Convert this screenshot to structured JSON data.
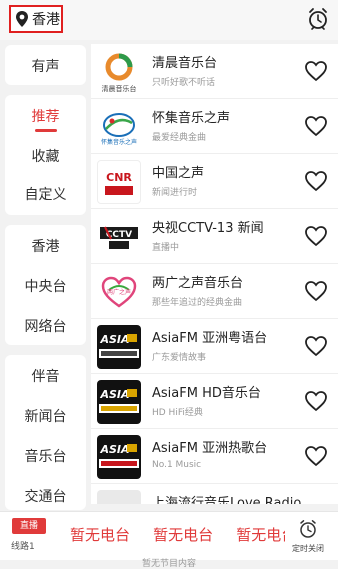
{
  "location": {
    "label": "香港"
  },
  "left_menu": {
    "top_card": [
      "有声"
    ],
    "middle_card": [
      "推荐",
      "收藏",
      "自定义"
    ],
    "region_card": [
      "香港",
      "中央台",
      "网络台"
    ],
    "genre_card": [
      "伴音",
      "新闻台",
      "音乐台",
      "交通台"
    ]
  },
  "stations": [
    {
      "title": "清晨音乐台",
      "subtitle": "只听好歌不听话",
      "logo_icon": "qingchen-logo-icon",
      "logo_text": "清晨音乐台"
    },
    {
      "title": "怀集音乐之声",
      "subtitle": "最爱经典金曲",
      "logo_icon": "huaiji-logo-icon",
      "logo_text": "怀集音乐之声"
    },
    {
      "title": "中国之声",
      "subtitle": "新闻进行时",
      "logo_icon": "cnr-logo-icon",
      "logo_text": "CNR"
    },
    {
      "title": "央视CCTV-13 新闻",
      "subtitle": "直播中",
      "logo_icon": "cctv-logo-icon",
      "logo_text": "CCTV"
    },
    {
      "title": "两广之声音乐台",
      "subtitle": "那些年追过的经典金曲",
      "logo_icon": "lianguang-logo-icon",
      "logo_text": "两广之声"
    },
    {
      "title": "AsiaFM 亚洲粤语台",
      "subtitle": "广东爱情故事",
      "logo_icon": "asiafm-yue-logo-icon",
      "logo_text": "ASIA"
    },
    {
      "title": "AsiaFM HD音乐台",
      "subtitle": "HD HiFi经典",
      "logo_icon": "asiafm-hd-logo-icon",
      "logo_text": "ASIA"
    },
    {
      "title": "AsiaFM 亚洲热歌台",
      "subtitle": "No.1 Music",
      "logo_icon": "asiafm-hot-logo-icon",
      "logo_text": "ASIA"
    },
    {
      "title": "上海流行音乐Love Radio",
      "subtitle": "",
      "logo_icon": "shanghai-logo-icon",
      "logo_text": ""
    }
  ],
  "player": {
    "live_badge": "直播",
    "line_label": "线路1",
    "ticker": [
      "暂无电台",
      "暂无电台",
      "暂无电台"
    ],
    "timer_label": "定时关闭",
    "bottom_hint": "暂无节目内容"
  },
  "colors": {
    "accent": "#e03a3a",
    "background": "#f2f2f2"
  }
}
